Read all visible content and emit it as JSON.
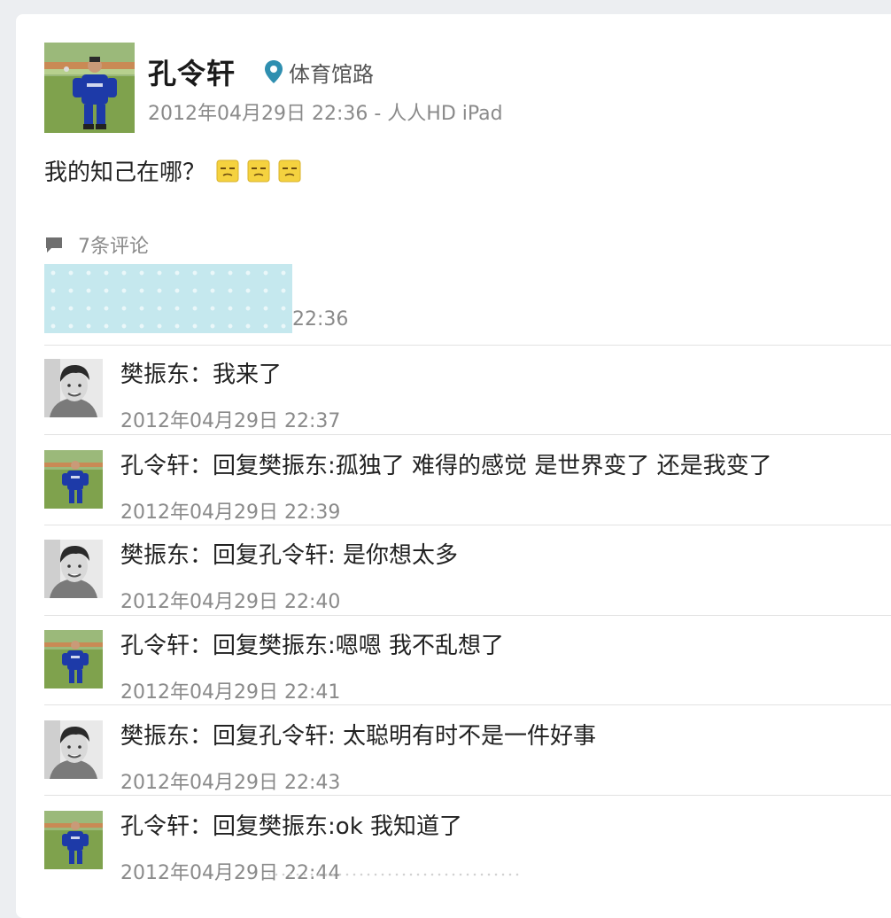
{
  "post": {
    "author": "孔令轩",
    "location": "体育馆路",
    "meta": "2012年04月29日 22:36 - 人人HD iPad",
    "content": "我的知己在哪？",
    "emoji_count": 3
  },
  "comments": {
    "count_label": "7条评论",
    "first_time_fragment": "22:36",
    "items": [
      {
        "name": "樊振东",
        "sep": "：",
        "text": "我来了",
        "time": "2012年04月29日 22:37",
        "avatar": "portrait"
      },
      {
        "name": "孔令轩",
        "sep": "：",
        "text": "回复樊振东:孤独了 难得的感觉 是世界变了 还是我变了",
        "time": "2012年04月29日 22:39",
        "avatar": "field"
      },
      {
        "name": "樊振东",
        "sep": "：",
        "text": "回复孔令轩: 是你想太多",
        "time": "2012年04月29日 22:40",
        "avatar": "portrait"
      },
      {
        "name": "孔令轩",
        "sep": "：",
        "text": "回复樊振东:嗯嗯 我不乱想了",
        "time": "2012年04月29日 22:41",
        "avatar": "field"
      },
      {
        "name": "樊振东",
        "sep": "：",
        "text": "回复孔令轩: 太聪明有时不是一件好事",
        "time": "2012年04月29日 22:43",
        "avatar": "portrait"
      },
      {
        "name": "孔令轩",
        "sep": "：",
        "text": "回复樊振东:ok 我知道了",
        "time": "2012年04月29日 22:44",
        "avatar": "field"
      }
    ]
  },
  "colors": {
    "location_pin": "#2f8fb0",
    "meta_gray": "#8a8a8a",
    "redaction": "#c5e8ee",
    "emoji": "#f5d23f",
    "jersey": "#1d3aa8",
    "grass": "#6f9a3b"
  },
  "icons": [
    "location-pin-icon",
    "comment-bubble-icon",
    "emoji-icon"
  ]
}
